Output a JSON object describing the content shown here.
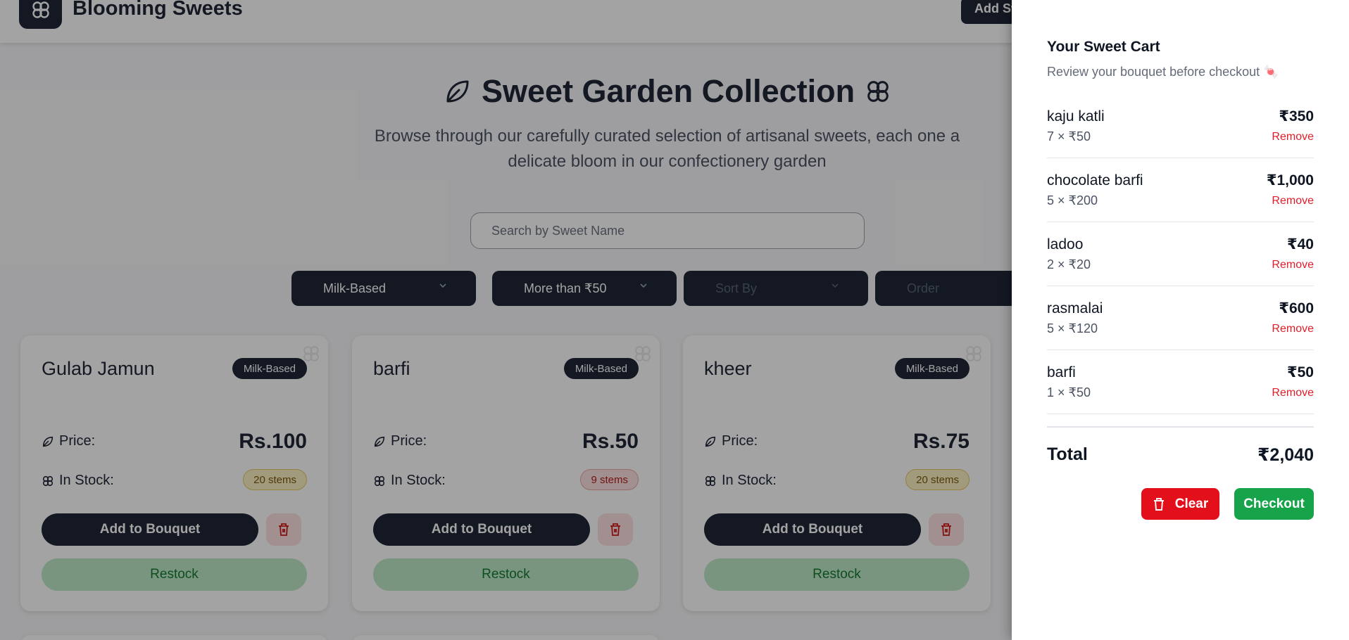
{
  "header": {
    "brand": "Blooming Sweets",
    "add_button_label": "Add Sweet",
    "logo_icon": "flower-icon"
  },
  "hero": {
    "title": "Sweet Garden Collection",
    "subtitle": "Browse through our carefully curated selection of artisanal sweets, each one a delicate bloom in our confectionery garden"
  },
  "search": {
    "placeholder": "Search by Sweet Name",
    "value": ""
  },
  "filters": [
    {
      "label": "Milk-Based"
    },
    {
      "label": "More than ₹50"
    },
    {
      "label": "Sort By"
    },
    {
      "label": "Order"
    }
  ],
  "cards": [
    {
      "name": "Gulab Jamun",
      "category": "Milk-Based",
      "price_label": "Price:",
      "price": "Rs.100",
      "stock_label": "In Stock:",
      "stock": "20 stems",
      "add_label": "Add to Bouquet",
      "restock_label": "Restock",
      "stock_status": "yellow"
    },
    {
      "name": "barfi",
      "category": "Milk-Based",
      "price_label": "Price:",
      "price": "Rs.50",
      "stock_label": "In Stock:",
      "stock": "9 stems",
      "add_label": "Add to Bouquet",
      "restock_label": "Restock",
      "stock_status": "red"
    },
    {
      "name": "kheer",
      "category": "Milk-Based",
      "price_label": "Price:",
      "price": "Rs.75",
      "stock_label": "In Stock:",
      "stock": "20 stems",
      "add_label": "Add to Bouquet",
      "restock_label": "Restock",
      "stock_status": "yellow"
    }
  ],
  "cart": {
    "title": "Your Sweet Cart",
    "subtitle": "Review your bouquet before checkout 🍬",
    "remove_label": "Remove",
    "items": [
      {
        "name": "kaju katli",
        "qty": "7 × ₹50",
        "total": "₹350"
      },
      {
        "name": "chocolate barfi",
        "qty": "5 × ₹200",
        "total": "₹1,000"
      },
      {
        "name": "ladoo",
        "qty": "2 × ₹20",
        "total": "₹40"
      },
      {
        "name": "rasmalai",
        "qty": "5 × ₹120",
        "total": "₹600"
      },
      {
        "name": "barfi",
        "qty": "1 × ₹50",
        "total": "₹50"
      }
    ],
    "total_label": "Total",
    "total_value": "₹2,040",
    "clear_label": "Clear",
    "checkout_label": "Checkout"
  },
  "colors": {
    "primary": "#1f2737",
    "danger": "#e3101c",
    "success": "#16a34a",
    "restock_bg": "#bde9c8"
  }
}
